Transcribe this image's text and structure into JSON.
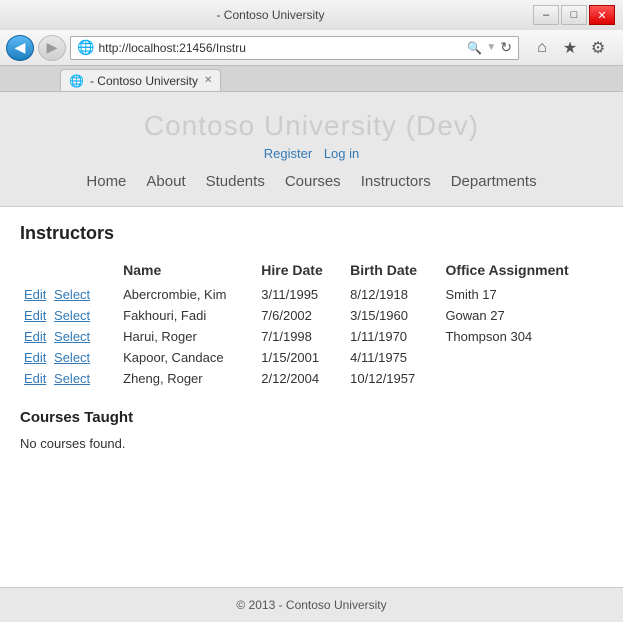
{
  "browser": {
    "title_bar": {
      "title": "- Contoso University",
      "minimize": "–",
      "maximize": "□",
      "close": "✕"
    },
    "nav": {
      "back_icon": "◀",
      "forward_icon": "▶",
      "address": "http://localhost:21456/Instru",
      "home_icon": "⌂",
      "star_icon": "★",
      "settings_icon": "⚙",
      "search_placeholder": ""
    },
    "tab": {
      "label": "- Contoso University",
      "close": "✕"
    }
  },
  "site": {
    "title": "Contoso University (Dev)",
    "links": {
      "register": "Register",
      "login": "Log in"
    },
    "nav": [
      {
        "label": "Home",
        "href": "#"
      },
      {
        "label": "About",
        "href": "#"
      },
      {
        "label": "Students",
        "href": "#"
      },
      {
        "label": "Courses",
        "href": "#"
      },
      {
        "label": "Instructors",
        "href": "#"
      },
      {
        "label": "Departments",
        "href": "#"
      }
    ]
  },
  "page": {
    "heading": "Instructors",
    "table": {
      "columns": [
        "",
        "Name",
        "Hire Date",
        "Birth Date",
        "Office Assignment"
      ],
      "rows": [
        {
          "edit": "Edit",
          "select": "Select",
          "name": "Abercrombie, Kim",
          "hire_date": "3/11/1995",
          "birth_date": "8/12/1918",
          "office": "Smith 17"
        },
        {
          "edit": "Edit",
          "select": "Select",
          "name": "Fakhouri, Fadi",
          "hire_date": "7/6/2002",
          "birth_date": "3/15/1960",
          "office": "Gowan 27"
        },
        {
          "edit": "Edit",
          "select": "Select",
          "name": "Harui, Roger",
          "hire_date": "7/1/1998",
          "birth_date": "1/11/1970",
          "office": "Thompson 304"
        },
        {
          "edit": "Edit",
          "select": "Select",
          "name": "Kapoor, Candace",
          "hire_date": "1/15/2001",
          "birth_date": "4/11/1975",
          "office": ""
        },
        {
          "edit": "Edit",
          "select": "Select",
          "name": "Zheng, Roger",
          "hire_date": "2/12/2004",
          "birth_date": "10/12/1957",
          "office": ""
        }
      ]
    },
    "courses_heading": "Courses Taught",
    "no_courses": "No courses found."
  },
  "footer": {
    "text": "© 2013 - Contoso University"
  }
}
